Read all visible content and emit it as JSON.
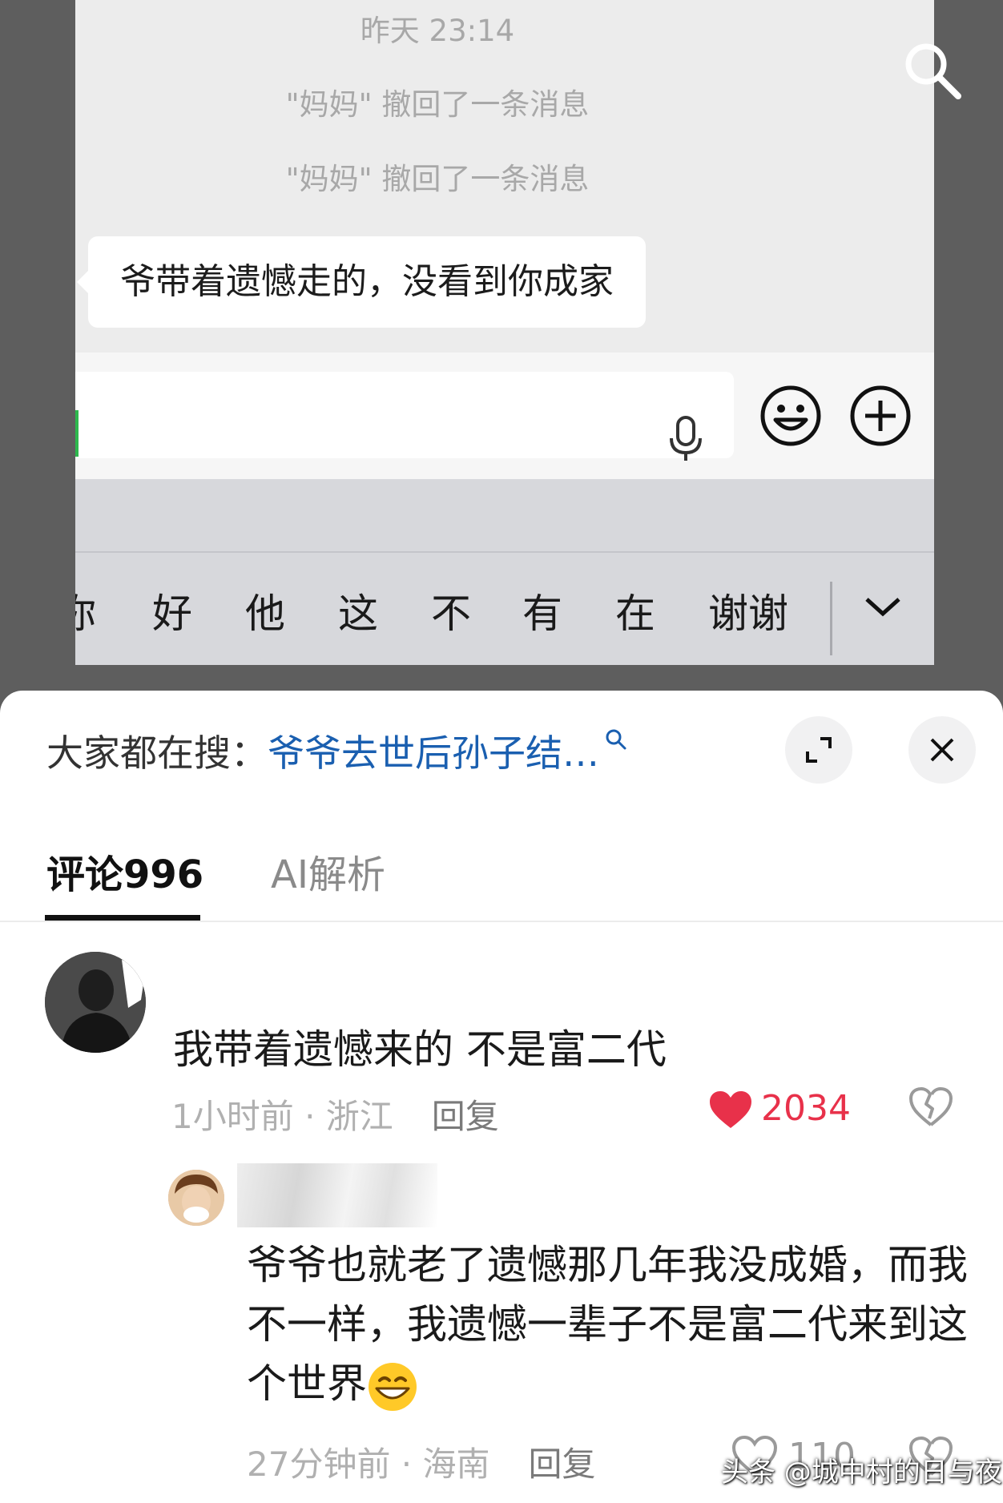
{
  "chat": {
    "timestamp": "昨天 23:14",
    "recall_1": "\"妈妈\" 撤回了一条消息",
    "recall_2": "\"妈妈\" 撤回了一条消息",
    "bubble": "爷带着遗憾走的，没看到你成家"
  },
  "keyboard": {
    "candidates": [
      "你",
      "好",
      "他",
      "这",
      "不",
      "有",
      "在",
      "谢谢"
    ]
  },
  "search": {
    "prefix": "大家都在搜：",
    "query": "爷爷去世后孙子结…"
  },
  "tabs": {
    "comments": "评论996",
    "ai": "AI解析"
  },
  "comments": [
    {
      "text": "我带着遗憾来的 不是富二代",
      "time_location": "1小时前 · 浙江",
      "reply": "回复",
      "likes": "2034"
    },
    {
      "text": "爷爷也就老了遗憾那几年我没成婚，而我不一样，我遗憾一辈子不是富二代来到这个世界",
      "time_location": "27分钟前 · 海南",
      "reply": "回复",
      "likes": "110"
    }
  ],
  "watermark": "头条 @城中村的日与夜",
  "colors": {
    "like_red": "#e8314a",
    "search_link": "#1a5fb0",
    "chat_bg": "#ececec",
    "keyboard_bg": "#d7d8dc"
  },
  "icons": [
    "search-icon",
    "microphone-icon",
    "emoji-icon",
    "plus-icon",
    "chevron-down-icon",
    "expand-icon",
    "close-icon",
    "heart-icon",
    "broken-heart-icon",
    "grin-emoji"
  ]
}
